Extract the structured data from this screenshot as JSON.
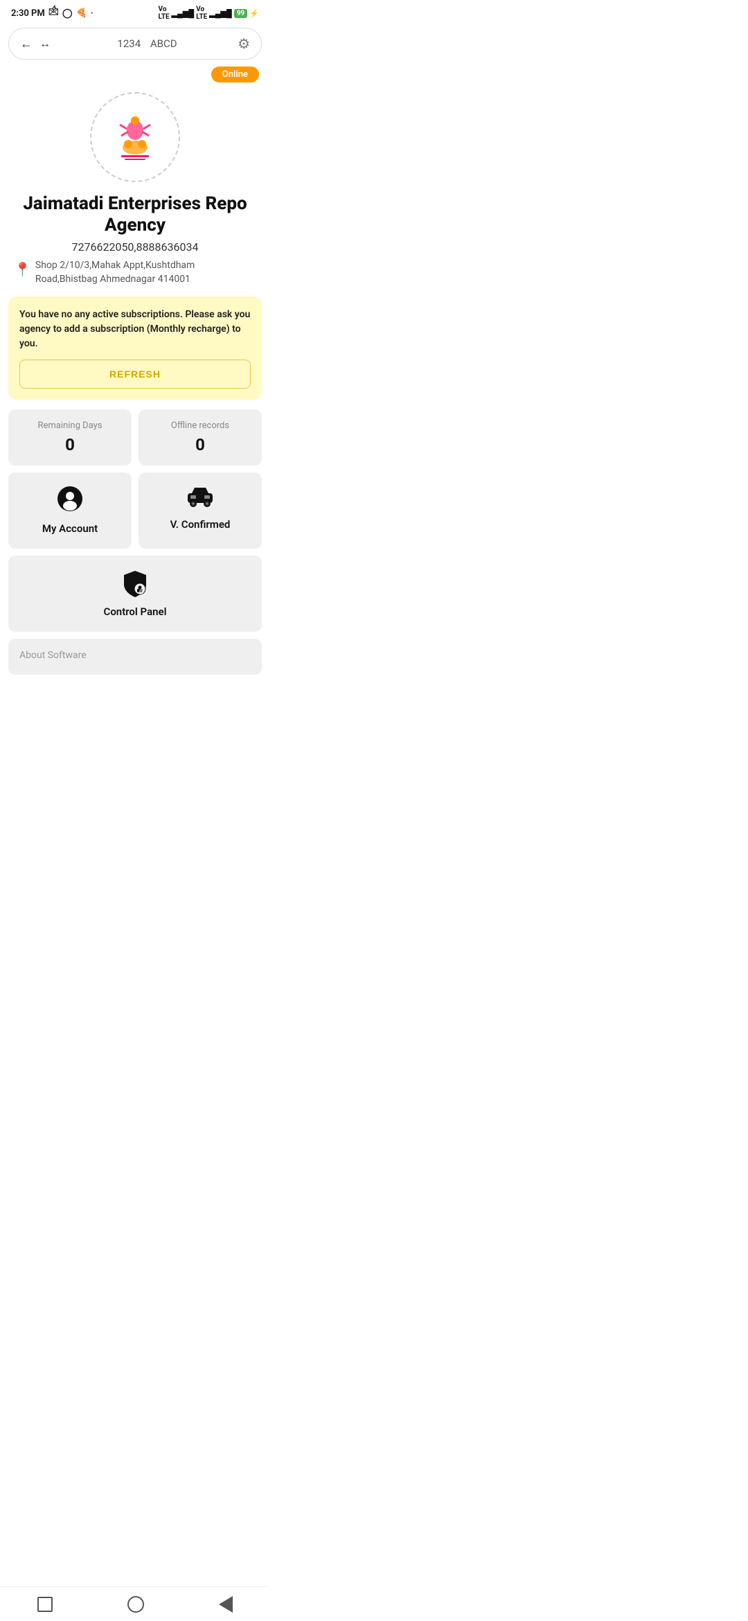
{
  "statusBar": {
    "time": "2:30 PM",
    "battery": "99"
  },
  "browserBar": {
    "urlCode": "1234",
    "urlSite": "ABCD"
  },
  "onlineBadge": "Online",
  "company": {
    "name": "Jaimatadi Enterprises Repo Agency",
    "phone": "7276622050,8888636034",
    "address": "Shop 2/10/3,Mahak Appt,Kushtdham Road,Bhistbag Ahmednagar 414001"
  },
  "subscription": {
    "message": "You have no any active subscriptions. Please ask you agency to add a subscription (Monthly recharge) to you.",
    "refreshLabel": "REFRESH"
  },
  "stats": [
    {
      "label": "Remaining Days",
      "value": "0"
    },
    {
      "label": "Offline records",
      "value": "0"
    }
  ],
  "menuItems": [
    {
      "label": "My Account",
      "icon": "account"
    },
    {
      "label": "V. Confirmed",
      "icon": "car"
    }
  ],
  "controlPanel": {
    "label": "Control Panel"
  },
  "aboutSection": {
    "label": "About Software"
  }
}
